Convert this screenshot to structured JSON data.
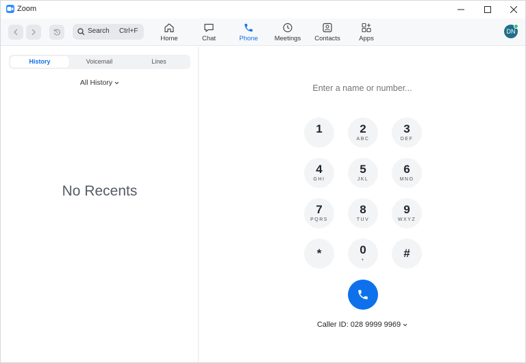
{
  "app": {
    "title": "Zoom"
  },
  "search": {
    "label": "Search",
    "shortcut": "Ctrl+F"
  },
  "nav": {
    "tabs": [
      {
        "label": "Home",
        "icon": "home-icon"
      },
      {
        "label": "Chat",
        "icon": "chat-icon"
      },
      {
        "label": "Phone",
        "icon": "phone-icon",
        "active": true
      },
      {
        "label": "Meetings",
        "icon": "clock-icon"
      },
      {
        "label": "Contacts",
        "icon": "contacts-icon"
      },
      {
        "label": "Apps",
        "icon": "apps-icon"
      }
    ]
  },
  "user": {
    "initials": "DN",
    "status": "available"
  },
  "left": {
    "segments": [
      "History",
      "Voicemail",
      "Lines"
    ],
    "active_segment": "History",
    "filter": "All History",
    "empty_message": "No Recents"
  },
  "dialer": {
    "placeholder": "Enter a name or number...",
    "keys": [
      {
        "digit": "1",
        "letters": ""
      },
      {
        "digit": "2",
        "letters": "ABC"
      },
      {
        "digit": "3",
        "letters": "DEF"
      },
      {
        "digit": "4",
        "letters": "GHI"
      },
      {
        "digit": "5",
        "letters": "JKL"
      },
      {
        "digit": "6",
        "letters": "MNO"
      },
      {
        "digit": "7",
        "letters": "PQRS"
      },
      {
        "digit": "8",
        "letters": "TUV"
      },
      {
        "digit": "9",
        "letters": "WXYZ"
      },
      {
        "digit": "*",
        "letters": ""
      },
      {
        "digit": "0",
        "letters": "+"
      },
      {
        "digit": "#",
        "letters": ""
      }
    ],
    "caller_id": "Caller ID: 028 9999 9969"
  },
  "colors": {
    "accent": "#0e71eb",
    "brand": "#2d8cff",
    "presence": "#28c76f"
  }
}
